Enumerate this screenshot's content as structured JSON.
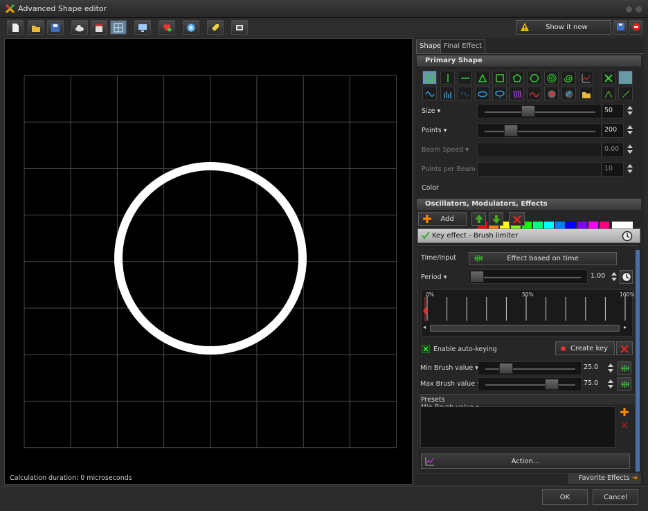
{
  "window": {
    "title": "Advanced Shape editor"
  },
  "toolbar": {
    "show_it_now": "Show it now"
  },
  "canvas": {
    "calc_text": "Calculation duration: 0 microseconds"
  },
  "tabs": {
    "shape": "Shape",
    "final_effect": "Final Effect"
  },
  "primary": {
    "title": "Primary Shape"
  },
  "props": {
    "size": {
      "label": "Size",
      "value": "50",
      "level": 0.38
    },
    "points": {
      "label": "Points",
      "value": "200",
      "level": 0.2
    },
    "beam_speed": {
      "label": "Beam Speed",
      "value": "0.00"
    },
    "ppb": {
      "label": "Points per Beam",
      "value": "10"
    },
    "color": {
      "label": "Color",
      "swatches": [
        "#ff0000",
        "#ff7f00",
        "#ffff00",
        "#7fff00",
        "#00ff00",
        "#00ff7f",
        "#00ffff",
        "#007fff",
        "#0000ff",
        "#7f00ff",
        "#ff00ff",
        "#ff007f",
        "#ffffff"
      ]
    }
  },
  "osc": {
    "title": "Oscillators, Modulators, Effects",
    "add": "Add"
  },
  "effect": {
    "key_title": "Key effect - Brush limiter",
    "time_input": "Time/Input",
    "time_button": "Effect based on time",
    "period": "Period",
    "period_value": "1.00",
    "timeline": {
      "p0": "0%",
      "p50": "50%",
      "p100": "100%"
    },
    "autokey": "Enable auto-keying",
    "create_key": "Create key",
    "min_brush": "Min Brush value",
    "min_value": "25.0",
    "max_brush": "Max Brush value",
    "max_value": "75.0",
    "presets": "Presets",
    "action": "Action...",
    "favorites": "Favorite Effects"
  },
  "footer": {
    "ok": "OK",
    "cancel": "Cancel"
  },
  "colors": {
    "accent": "#7ec4e6",
    "arrow_green": "#44aa22",
    "delete_red": "#dd2222",
    "add_orange": "#ff8800"
  }
}
